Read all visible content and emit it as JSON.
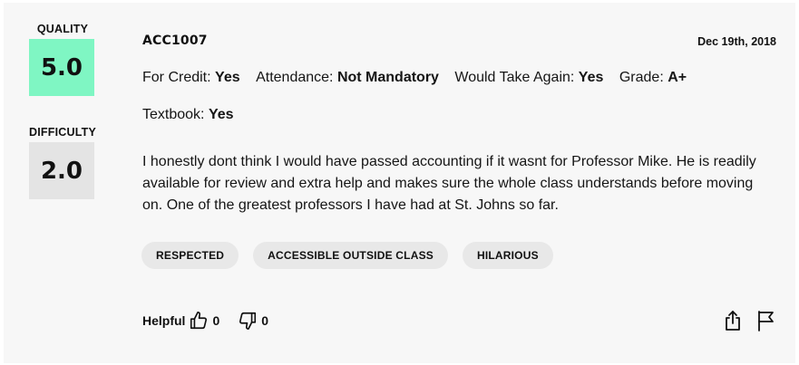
{
  "rating": {
    "quality_label": "QUALITY",
    "quality_value": "5.0",
    "quality_color": "#7ff6c3",
    "difficulty_label": "DIFFICULTY",
    "difficulty_value": "2.0",
    "difficulty_color": "#e4e4e4"
  },
  "review": {
    "course": "ACC1007",
    "date": "Dec 19th, 2018",
    "meta": {
      "for_credit_label": "For Credit:",
      "for_credit_value": "Yes",
      "attendance_label": "Attendance:",
      "attendance_value": "Not Mandatory",
      "would_take_again_label": "Would Take Again:",
      "would_take_again_value": "Yes",
      "grade_label": "Grade:",
      "grade_value": "A+",
      "textbook_label": "Textbook:",
      "textbook_value": "Yes"
    },
    "comment": "I honestly dont think I would have passed accounting if it wasnt for Professor Mike. He is readily available for review and extra help and makes sure the whole class understands before moving on. One of the greatest professors I have had at St. Johns so far.",
    "tags": [
      "RESPECTED",
      "ACCESSIBLE OUTSIDE CLASS",
      "HILARIOUS"
    ]
  },
  "footer": {
    "helpful_label": "Helpful",
    "thumbs_up_count": "0",
    "thumbs_down_count": "0",
    "icons": [
      "thumbs-up-icon",
      "thumbs-down-icon",
      "share-icon",
      "flag-icon"
    ]
  }
}
